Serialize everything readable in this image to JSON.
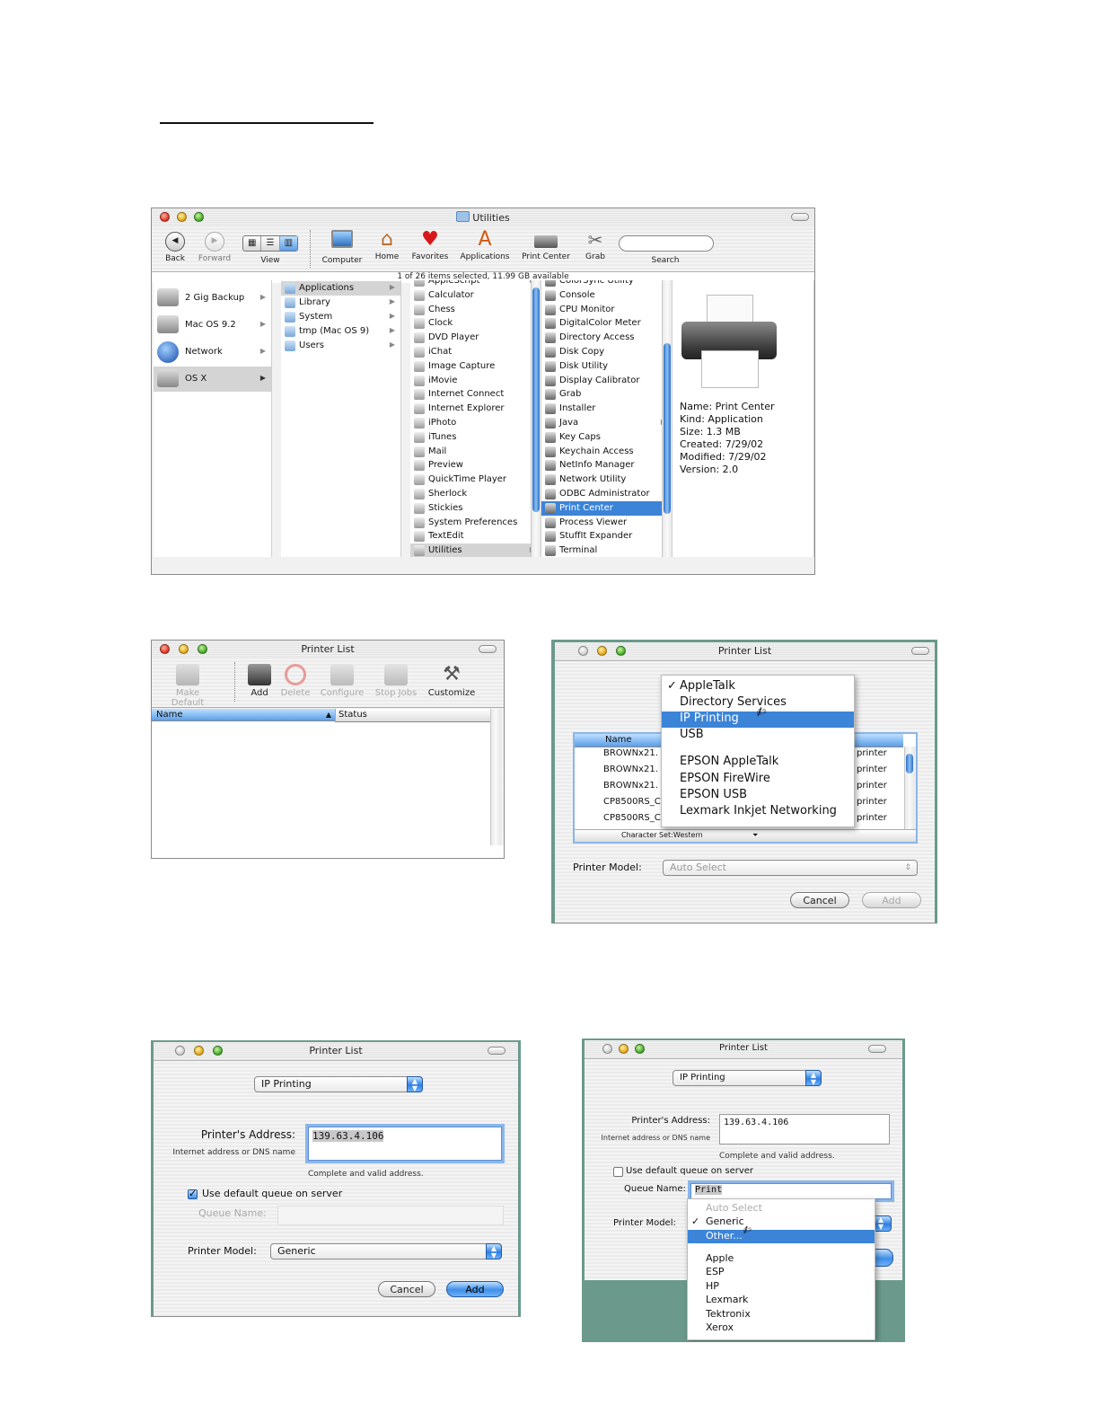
{
  "finder": {
    "title": "Utilities",
    "toolbar": [
      "Back",
      "Forward",
      "View",
      "Computer",
      "Home",
      "Favorites",
      "Applications",
      "Print Center",
      "Grab"
    ],
    "search_label": "Search",
    "status": "1 of 26 items selected, 11.99 GB available",
    "volumes": [
      "2 Gig Backup",
      "Mac OS 9.2",
      "Network",
      "OS X"
    ],
    "col2": [
      "Applications",
      "Library",
      "System",
      "tmp (Mac OS 9)",
      "Users"
    ],
    "col3": [
      "AppleScript",
      "Calculator",
      "Chess",
      "Clock",
      "DVD Player",
      "iChat",
      "Image Capture",
      "iMovie",
      "Internet Connect",
      "Internet Explorer",
      "iPhoto",
      "iTunes",
      "Mail",
      "Preview",
      "QuickTime Player",
      "Sherlock",
      "Stickies",
      "System Preferences",
      "TextEdit",
      "Utilities"
    ],
    "col4": [
      "ColorSync Utility",
      "Console",
      "CPU Monitor",
      "DigitalColor Meter",
      "Directory Access",
      "Disk Copy",
      "Disk Utility",
      "Display Calibrator",
      "Grab",
      "Installer",
      "Java",
      "Key Caps",
      "Keychain Access",
      "NetInfo Manager",
      "Network Utility",
      "ODBC Administrator",
      "Print Center",
      "Process Viewer",
      "StuffIt Expander",
      "Terminal"
    ],
    "info": [
      "Name:  Print Center",
      "Kind:  Application",
      "Size:  1.3 MB",
      "Created:  7/29/02",
      "Modified:  7/29/02",
      "Version:  2.0"
    ]
  },
  "printer_list_1": {
    "title": "Printer List",
    "tools": [
      "Make Default",
      "Add",
      "Delete",
      "Configure",
      "Stop Jobs",
      "Customize"
    ],
    "col_name": "Name",
    "col_status": "Status"
  },
  "printer_list_2": {
    "title": "Printer List",
    "menu": [
      "AppleTalk",
      "Directory Services",
      "IP Printing",
      "USB",
      "EPSON AppleTalk",
      "EPSON FireWire",
      "EPSON USB",
      "Lexmark Inkjet Networking"
    ],
    "list_header": "Name",
    "rows": [
      "BROWNx21.",
      "BROWNx21.",
      "BROWNx21.",
      "CP8500RS_C",
      "CP8500RS_C"
    ],
    "row_right": [
      "printer",
      "printer",
      "printer",
      "printer",
      "printer"
    ],
    "charset": "Character Set:Western",
    "model_label": "Printer Model:",
    "model_value": "Auto Select",
    "cancel": "Cancel",
    "add": "Add"
  },
  "printer_list_3": {
    "title": "Printer List",
    "connection": "IP Printing",
    "address_label": "Printer's Address:",
    "address_hint": "Internet address or DNS name",
    "address_value": "139.63.4.106",
    "valid": "Complete and valid address.",
    "default_queue": "Use default queue on server",
    "queue_label": "Queue Name:",
    "model_label": "Printer Model:",
    "model_value": "Generic",
    "cancel": "Cancel",
    "add": "Add"
  },
  "printer_list_4": {
    "title": "Printer List",
    "connection": "IP Printing",
    "address_label": "Printer's Address:",
    "address_hint": "Internet address or DNS name",
    "address_value": "139.63.4.106",
    "valid": "Complete and valid address.",
    "default_queue": "Use default queue on server",
    "queue_label": "Queue Name:",
    "queue_value": "Print",
    "model_label": "Printer Model:",
    "menu": [
      "Auto Select",
      "Generic",
      "Other...",
      "Apple",
      "ESP",
      "HP",
      "Lexmark",
      "Tektronix",
      "Xerox"
    ]
  }
}
